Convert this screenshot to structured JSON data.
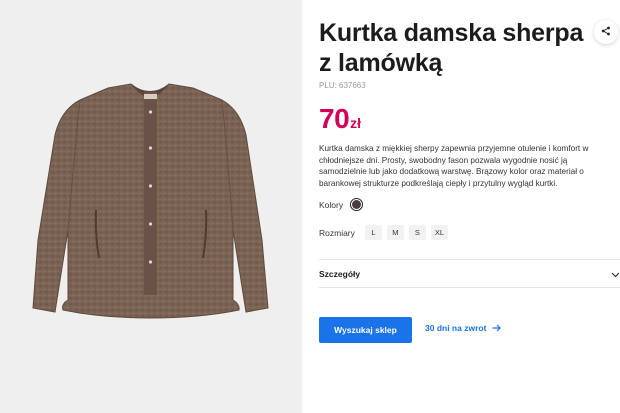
{
  "product": {
    "title": "Kurtka damska sherpa z lamówką",
    "plu": "PLU: 637663",
    "price_value": "70",
    "price_currency": "zł",
    "description": "Kurtka damska z miękkiej sherpy zapewnia przyjemne otulenie i komfort w chłodniejsze dni. Prosty, swobodny fason pozwala wygodnie nosić ją samodzielnie lub jako dodatkową warstwę. Brązowy kolor oraz materiał o barankowej strukturze podkreślają ciepły i przytulny wygląd kurtki.",
    "image_icon": "jacket-photo"
  },
  "colors": {
    "label": "Kolory",
    "selected": "#4a3c3c"
  },
  "sizes": {
    "label": "Rozmiary",
    "options": [
      "L",
      "M",
      "S",
      "XL"
    ]
  },
  "details": {
    "label": "Szczegóły",
    "icon": "chevron-down-icon"
  },
  "actions": {
    "find_store": "Wyszukaj sklep",
    "return_link": "30 dni na zwrot",
    "share_icon": "share-icon"
  },
  "theme": {
    "price_color": "#d1005a",
    "accent": "#1a73e8"
  }
}
